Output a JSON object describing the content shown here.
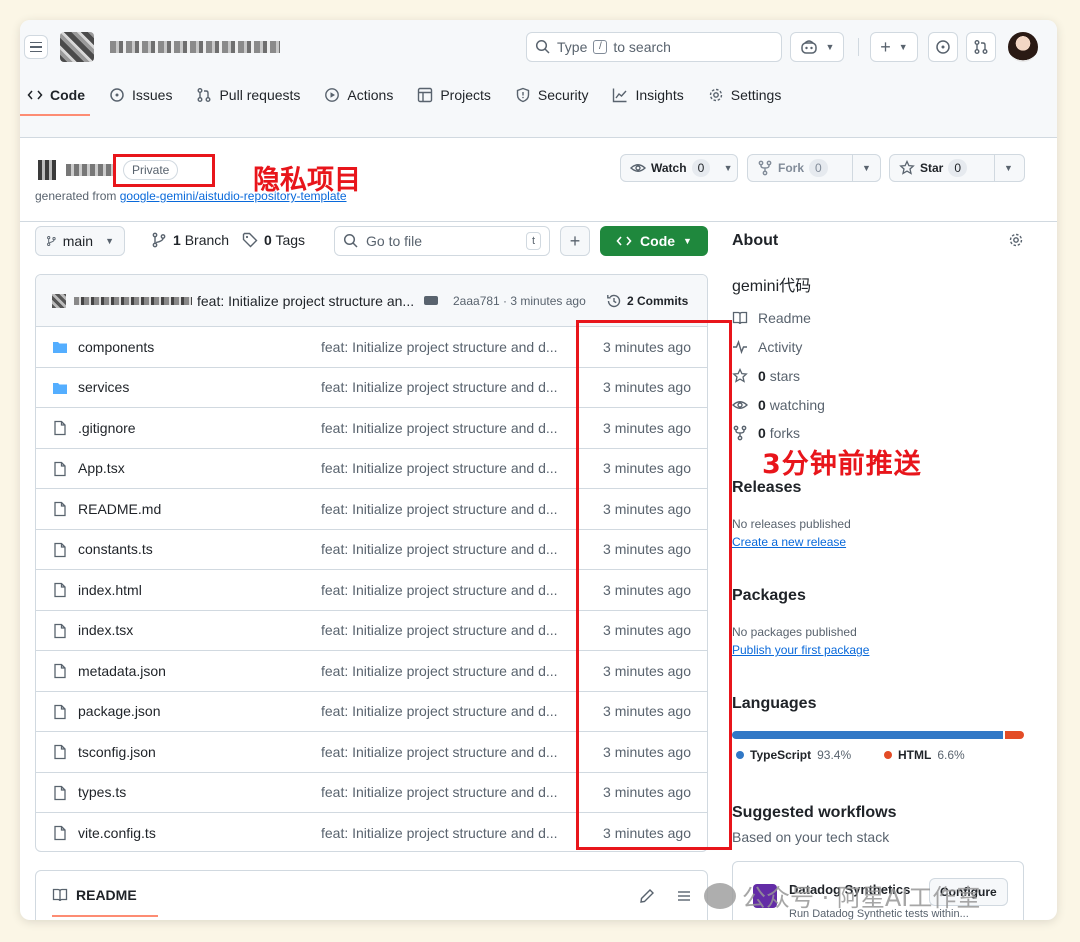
{
  "header": {
    "search_placeholder_pre": "Type",
    "search_key": "/",
    "search_placeholder_post": "to search",
    "plus": "+"
  },
  "nav": {
    "tabs": [
      {
        "label": "Code",
        "icon": "code-icon",
        "active": true
      },
      {
        "label": "Issues",
        "icon": "issue-icon"
      },
      {
        "label": "Pull requests",
        "icon": "pull-request-icon"
      },
      {
        "label": "Actions",
        "icon": "play-icon"
      },
      {
        "label": "Projects",
        "icon": "table-icon"
      },
      {
        "label": "Security",
        "icon": "shield-icon"
      },
      {
        "label": "Insights",
        "icon": "graph-icon"
      },
      {
        "label": "Settings",
        "icon": "gear-icon"
      }
    ]
  },
  "repo": {
    "visibility": "Private",
    "generated_from_prefix": "generated from",
    "template_link": "google-gemini/aistudio-repository-template",
    "watch": {
      "label": "Watch",
      "count": "0"
    },
    "fork": {
      "label": "Fork",
      "count": "0"
    },
    "star": {
      "label": "Star",
      "count": "0"
    }
  },
  "annotations": {
    "private_note": "隐私项目",
    "time_note": "3分钟前推送",
    "box_color": "#e8151b"
  },
  "toolbar": {
    "branch": "main",
    "branches_count": "1",
    "branches_label": "Branch",
    "tags_count": "0",
    "tags_label": "Tags",
    "goto_placeholder": "Go to file",
    "goto_key": "t",
    "add": "+",
    "code_label": "Code"
  },
  "latest_commit": {
    "message": "feat: Initialize project structure an...",
    "meta": "2aaa781 · 3 minutes ago",
    "commits_label": "2 Commits"
  },
  "files": [
    {
      "name": "components",
      "type": "dir",
      "message": "feat: Initialize project structure and d...",
      "time": "3 minutes ago"
    },
    {
      "name": "services",
      "type": "dir",
      "message": "feat: Initialize project structure and d...",
      "time": "3 minutes ago"
    },
    {
      "name": ".gitignore",
      "type": "file",
      "message": "feat: Initialize project structure and d...",
      "time": "3 minutes ago"
    },
    {
      "name": "App.tsx",
      "type": "file",
      "message": "feat: Initialize project structure and d...",
      "time": "3 minutes ago"
    },
    {
      "name": "README.md",
      "type": "file",
      "message": "feat: Initialize project structure and d...",
      "time": "3 minutes ago"
    },
    {
      "name": "constants.ts",
      "type": "file",
      "message": "feat: Initialize project structure and d...",
      "time": "3 minutes ago"
    },
    {
      "name": "index.html",
      "type": "file",
      "message": "feat: Initialize project structure and d...",
      "time": "3 minutes ago"
    },
    {
      "name": "index.tsx",
      "type": "file",
      "message": "feat: Initialize project structure and d...",
      "time": "3 minutes ago"
    },
    {
      "name": "metadata.json",
      "type": "file",
      "message": "feat: Initialize project structure and d...",
      "time": "3 minutes ago"
    },
    {
      "name": "package.json",
      "type": "file",
      "message": "feat: Initialize project structure and d...",
      "time": "3 minutes ago"
    },
    {
      "name": "tsconfig.json",
      "type": "file",
      "message": "feat: Initialize project structure and d...",
      "time": "3 minutes ago"
    },
    {
      "name": "types.ts",
      "type": "file",
      "message": "feat: Initialize project structure and d...",
      "time": "3 minutes ago"
    },
    {
      "name": "vite.config.ts",
      "type": "file",
      "message": "feat: Initialize project structure and d...",
      "time": "3 minutes ago"
    }
  ],
  "readme": {
    "title": "README"
  },
  "about": {
    "heading": "About",
    "description": "gemini代码",
    "readme": "Readme",
    "activity": "Activity",
    "stars_count": "0",
    "stars_label": "stars",
    "watching_count": "0",
    "watching_label": "watching",
    "forks_count": "0",
    "forks_label": "forks"
  },
  "releases": {
    "heading": "Releases",
    "none": "No releases published",
    "link": "Create a new release"
  },
  "packages": {
    "heading": "Packages",
    "none": "No packages published",
    "link": "Publish your first package"
  },
  "languages": {
    "heading": "Languages",
    "items": [
      {
        "name": "TypeScript",
        "percent": "93.4%",
        "share": 93.4,
        "color": "#3178c6"
      },
      {
        "name": "HTML",
        "percent": "6.6%",
        "share": 6.6,
        "color": "#e34c26"
      }
    ]
  },
  "workflows": {
    "heading": "Suggested workflows",
    "subheading": "Based on your tech stack",
    "card_name": "Datadog Synthetics",
    "card_button": "Configure",
    "card_desc": "Run Datadog Synthetic tests within..."
  },
  "watermark": {
    "text": "公众号 · 阿星AI工作室"
  }
}
